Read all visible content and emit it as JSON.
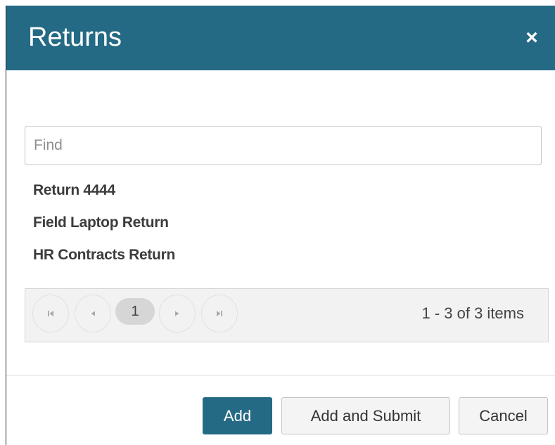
{
  "dialog": {
    "title": "Returns",
    "close_glyph": "×",
    "close_icon": "close-icon"
  },
  "search": {
    "placeholder": "Find",
    "value": ""
  },
  "items": [
    {
      "label": "Return 4444"
    },
    {
      "label": "Field Laptop Return"
    },
    {
      "label": "HR Contracts Return"
    }
  ],
  "pager": {
    "current_page": "1",
    "info": "1 - 3 of 3 items",
    "icons": [
      "first-page-icon",
      "prev-page-icon",
      "next-page-icon",
      "last-page-icon"
    ]
  },
  "footer": {
    "add_label": "Add",
    "add_submit_label": "Add and Submit",
    "cancel_label": "Cancel"
  },
  "colors": {
    "header": "#256a85",
    "primary_button": "#256a85",
    "pager_background": "#f2f2f2"
  }
}
